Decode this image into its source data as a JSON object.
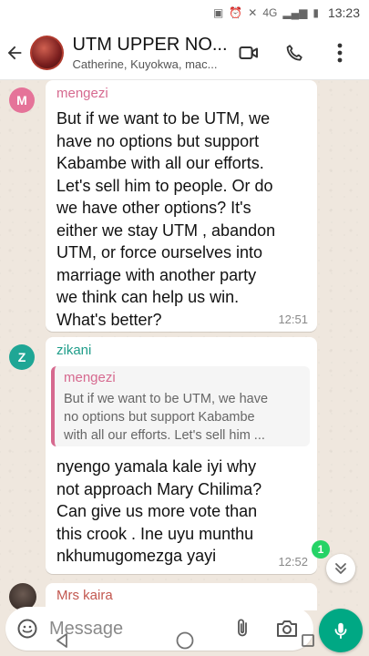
{
  "status_bar": {
    "network": "4G",
    "time": "13:23"
  },
  "header": {
    "title": "UTM UPPER NO...",
    "subtitle": "Catherine, Kuyokwa, mac...",
    "icons": [
      "back-arrow-icon",
      "video-call-icon",
      "phone-icon",
      "more-vert-icon"
    ]
  },
  "messages": [
    {
      "avatar_letter": "M",
      "avatar_color": "#e57399",
      "sender": "mengezi",
      "sender_color": "#d6698f",
      "text": "But if we want to be UTM, we\nhave no options but support\nKabambe with all our efforts.\nLet's sell him to people. Or do\nwe have other options? It's\neither we stay UTM , abandon\nUTM, or force ourselves into\nmarriage with another party\nwe think can help us win.\nWhat's better?",
      "time": "12:51"
    },
    {
      "avatar_letter": "Z",
      "avatar_color": "#1fa695",
      "sender": "zikani",
      "sender_color": "#1f9d8a",
      "quote": {
        "sender": "mengezi",
        "text": "But if we want to be UTM, we have\nno options but support Kabambe\nwith all our efforts. Let's sell him ..."
      },
      "text": "nyengo yamala kale iyi why\nnot approach Mary Chilima?\nCan give us more vote than\nthis crook . Ine uyu munthu\nnkhumugomezga yayi",
      "time": "12:52"
    }
  ],
  "next_message": {
    "sender": "Mrs kaira"
  },
  "unread_count": "1",
  "composer": {
    "placeholder": "Message"
  },
  "colors": {
    "accent": "#00a884",
    "badge": "#25d366",
    "chat_bg": "#efe7de"
  }
}
